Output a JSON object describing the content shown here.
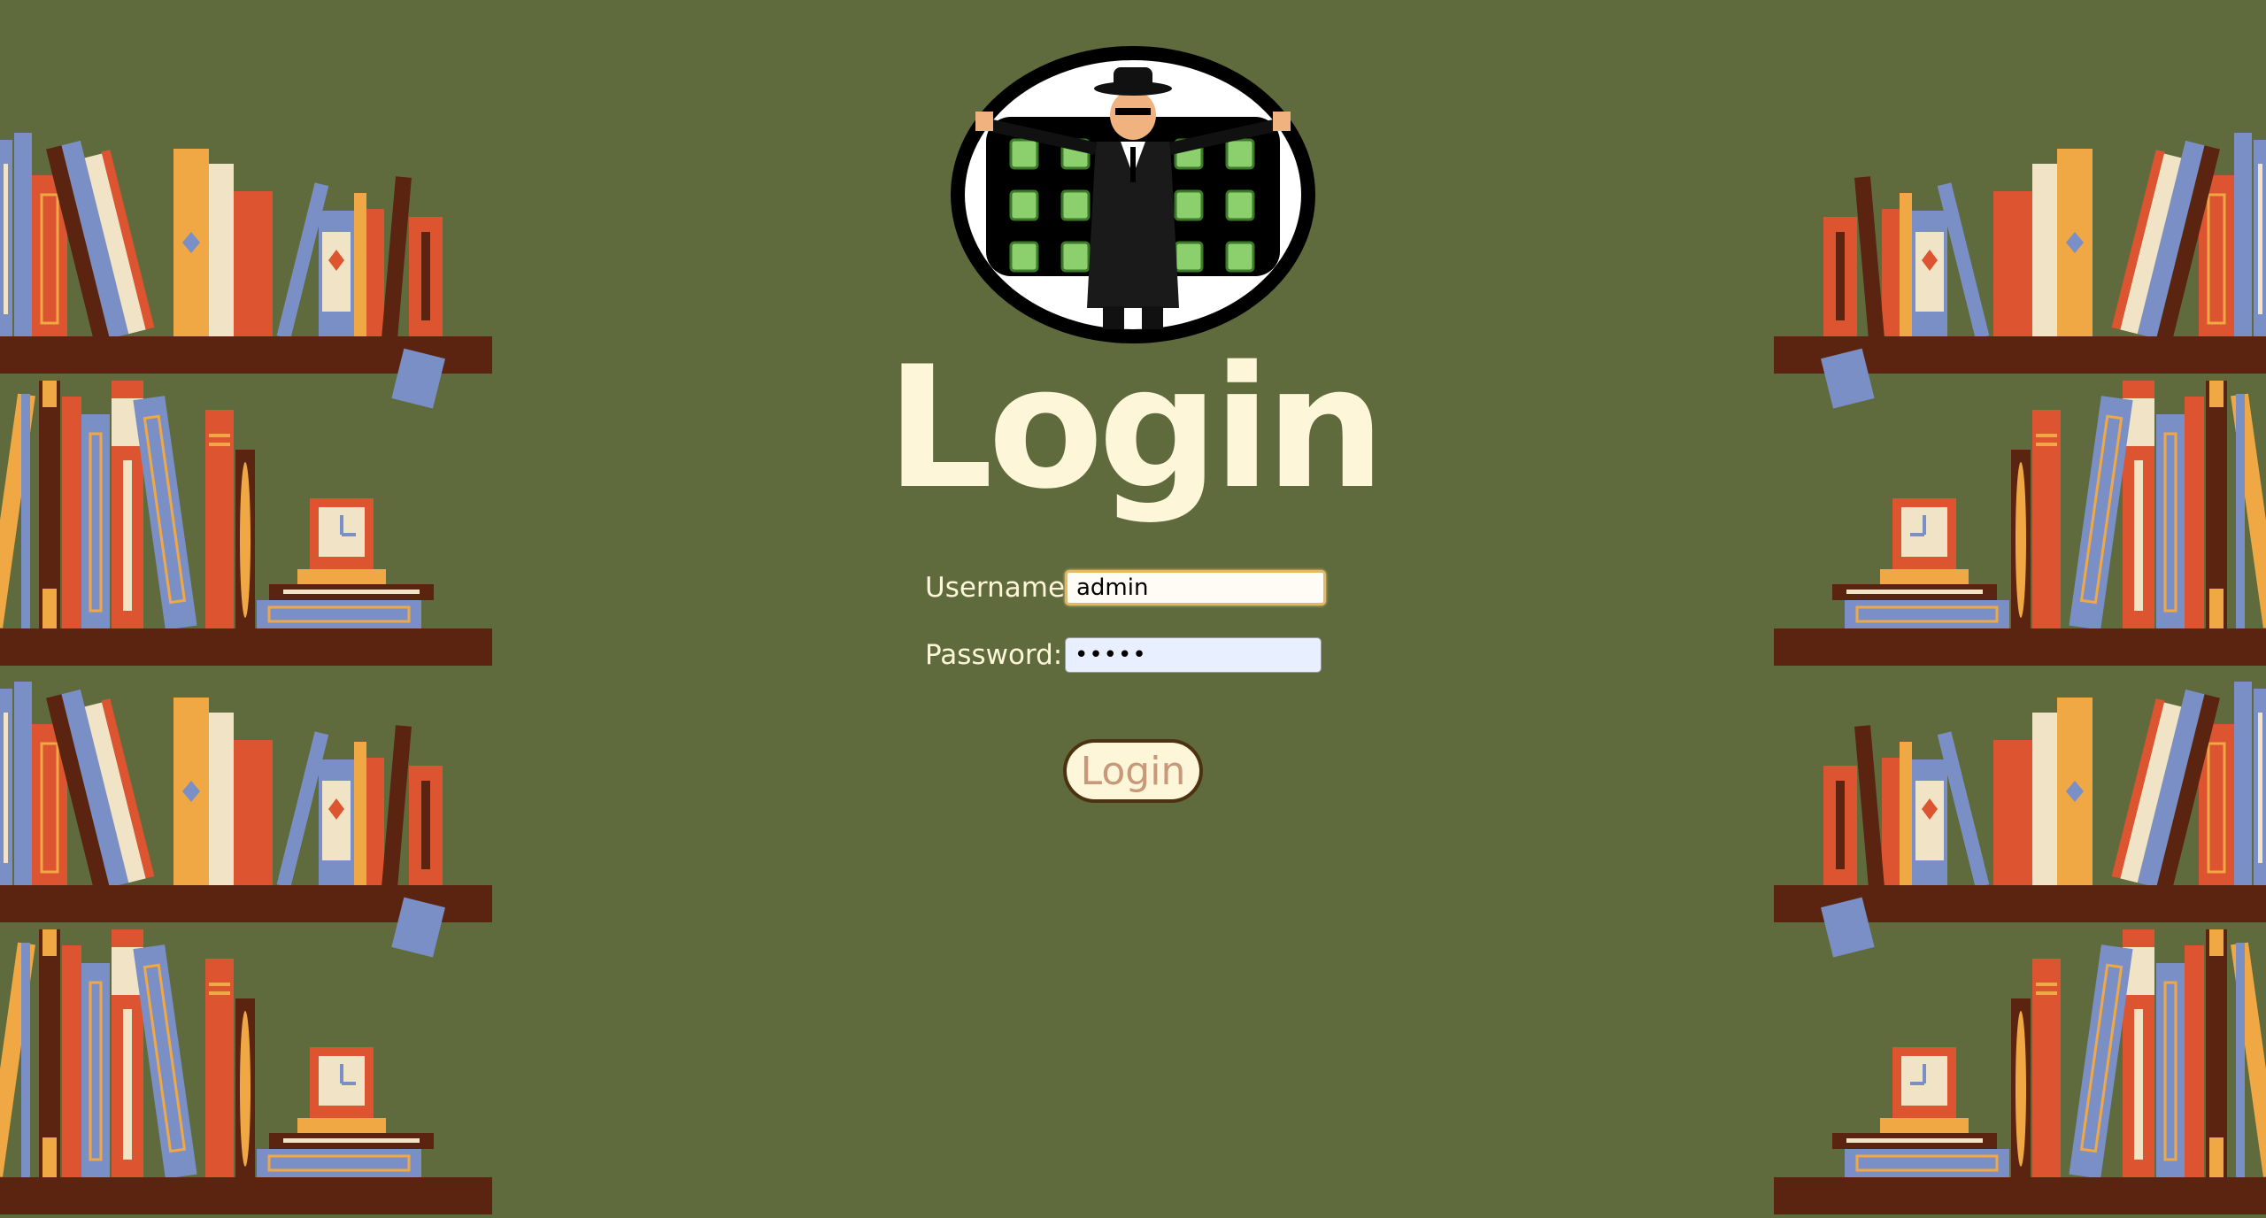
{
  "page": {
    "title": "Login"
  },
  "form": {
    "username_label": "Username:",
    "username_value": "admin",
    "password_label": "Password:",
    "password_value": "•••••",
    "submit_label": "Login"
  },
  "colors": {
    "background": "#5f6b3c",
    "title": "#fdf6d8",
    "button_border": "#4b3210",
    "button_text": "#c8987a"
  },
  "decoration": {
    "left": "bookshelves",
    "right": "bookshelves",
    "logo": "spy-with-notes"
  }
}
